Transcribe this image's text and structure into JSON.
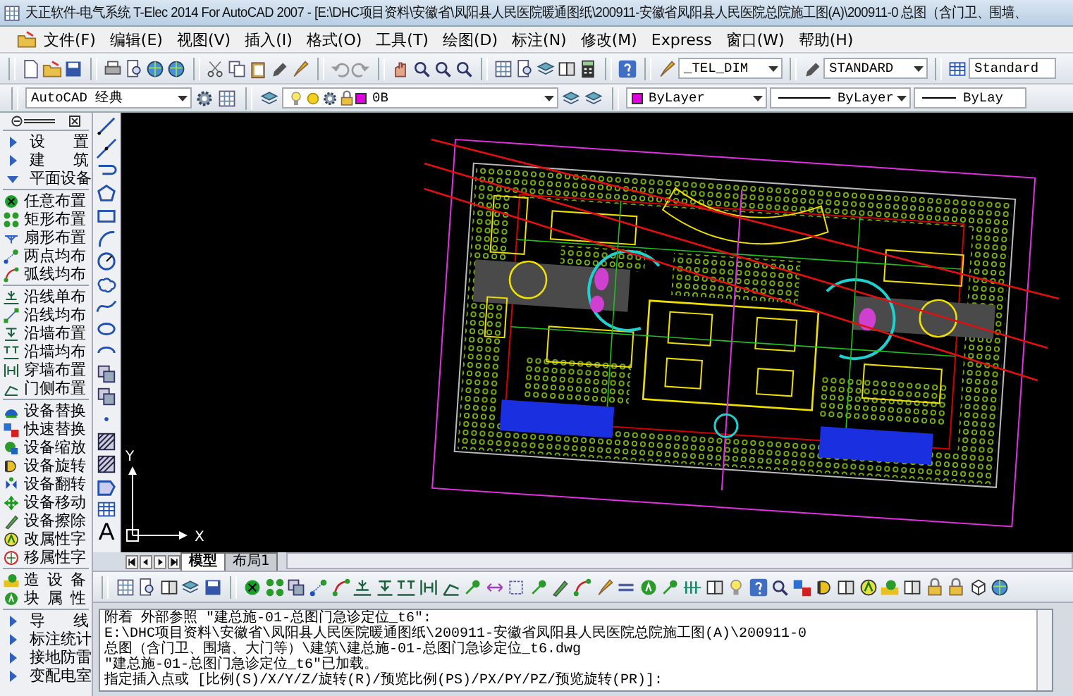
{
  "window": {
    "title": "天正软件-电气系统 T-Elec 2014  For AutoCAD 2007 - [E:\\DHC项目资料\\安徽省\\凤阳县人民医院暖通图纸\\200911-安徽省凤阳县人民医院总院施工图(A)\\200911-0 总图（含门卫、围墙、"
  },
  "menu": [
    "文件(F)",
    "编辑(E)",
    "视图(V)",
    "插入(I)",
    "格式(O)",
    "工具(T)",
    "绘图(D)",
    "标注(N)",
    "修改(M)",
    "Express",
    "窗口(W)",
    "帮助(H)"
  ],
  "styles_toolbar": {
    "text_style": "_TEL_DIM",
    "dim_style": "STANDARD",
    "table_style": "Standard"
  },
  "workspace": "AutoCAD 经典",
  "layer": {
    "name": "0B",
    "color": "#e000e0"
  },
  "properties": {
    "color_dropdown": {
      "label": "ByLayer",
      "color": "#e000e0"
    },
    "linetype": "ByLayer",
    "lineweight": "ByLay"
  },
  "palette": {
    "sections": [
      {
        "items": [
          {
            "kind": "group",
            "label": "设置",
            "expanded": false
          },
          {
            "kind": "group",
            "label": "建筑",
            "expanded": false
          },
          {
            "kind": "group",
            "label": "平面设备",
            "expanded": true
          }
        ]
      },
      {
        "items": [
          {
            "kind": "tool",
            "label": "任意布置"
          },
          {
            "kind": "tool",
            "label": "矩形布置"
          },
          {
            "kind": "tool",
            "label": "扇形布置"
          },
          {
            "kind": "tool",
            "label": "两点均布"
          },
          {
            "kind": "tool",
            "label": "弧线均布"
          }
        ]
      },
      {
        "items": [
          {
            "kind": "tool",
            "label": "沿线单布"
          },
          {
            "kind": "tool",
            "label": "沿线均布"
          },
          {
            "kind": "tool",
            "label": "沿墙布置"
          },
          {
            "kind": "tool",
            "label": "沿墙均布"
          },
          {
            "kind": "tool",
            "label": "穿墙布置"
          },
          {
            "kind": "tool",
            "label": "门侧布置"
          }
        ]
      },
      {
        "items": [
          {
            "kind": "tool",
            "label": "设备替换"
          },
          {
            "kind": "tool",
            "label": "快速替换"
          },
          {
            "kind": "tool",
            "label": "设备缩放"
          },
          {
            "kind": "tool",
            "label": "设备旋转"
          },
          {
            "kind": "tool",
            "label": "设备翻转"
          },
          {
            "kind": "tool",
            "label": "设备移动"
          },
          {
            "kind": "tool",
            "label": "设备擦除"
          },
          {
            "kind": "tool",
            "label": "改属性字"
          },
          {
            "kind": "tool",
            "label": "移属性字"
          }
        ]
      },
      {
        "items": [
          {
            "kind": "tool",
            "label": "造设备"
          },
          {
            "kind": "tool",
            "label": "块属性"
          }
        ]
      },
      {
        "items": [
          {
            "kind": "group",
            "label": "导线",
            "expanded": false
          },
          {
            "kind": "group",
            "label": "标注统计",
            "expanded": false
          },
          {
            "kind": "group",
            "label": "接地防雷",
            "expanded": false
          },
          {
            "kind": "group",
            "label": "变配电室",
            "expanded": false
          }
        ]
      }
    ]
  },
  "draw_toolbar": {
    "text_tool_glyph": "A"
  },
  "ucs": {
    "x_label": "X",
    "y_label": "Y"
  },
  "layout_tabs": [
    {
      "label": "模型",
      "selected": true
    },
    {
      "label": "布局1",
      "selected": false
    }
  ],
  "command_lines": [
    "附着 外部参照 \"建总施-01-总图门急诊定位_t6\":",
    "E:\\DHC项目资料\\安徽省\\凤阳县人民医院暖通图纸\\200911-安徽省凤阳县人民医院总院施工图(A)\\200911-0",
    "总图（含门卫、围墙、大门等）\\建筑\\建总施-01-总图门急诊定位_t6.dwg",
    "\"建总施-01-总图门急诊定位_t6\"已加载。",
    "指定插入点或 [比例(S)/X/Y/Z/旋转(R)/预览比例(PS)/PX/PY/PZ/预览旋转(PR)]:"
  ]
}
